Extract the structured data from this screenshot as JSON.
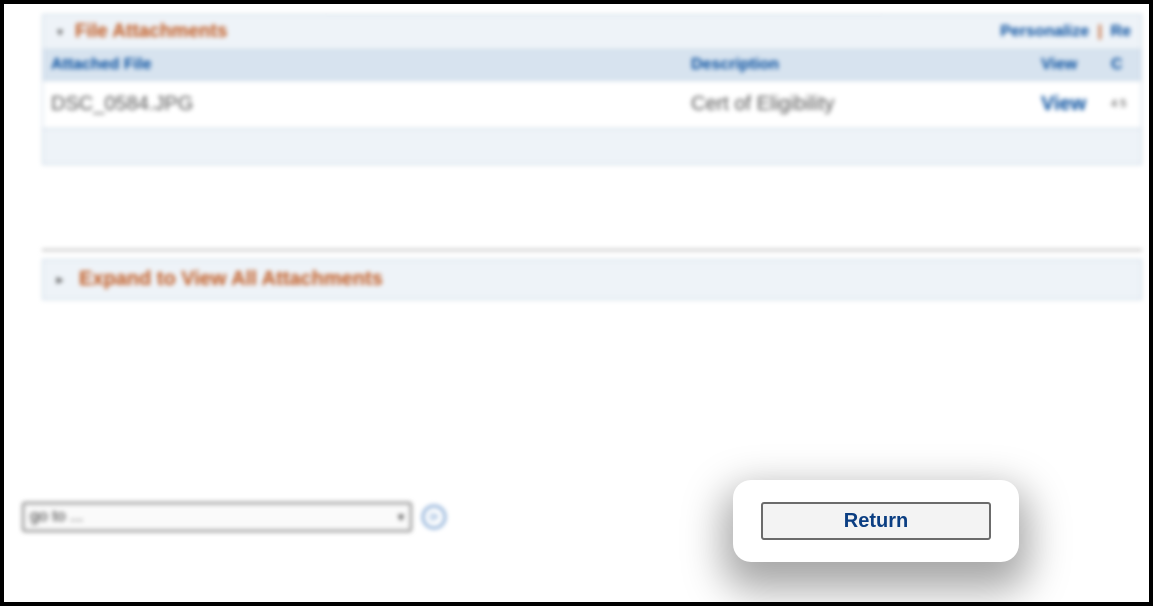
{
  "section": {
    "title": "File Attachments",
    "actions": {
      "personalize": "Personalize",
      "refresh": "Re"
    },
    "columns": {
      "file": "Attached File",
      "desc": "Description",
      "view": "View",
      "other": "C"
    },
    "rows": [
      {
        "file": "DSC_0584.JPG",
        "desc": "Cert of Eligibility",
        "view": "View",
        "other": "4\n5"
      }
    ]
  },
  "expand": {
    "label": "Expand to View All Attachments"
  },
  "nav": {
    "goto_placeholder": "go to ..."
  },
  "buttons": {
    "return": "Return"
  }
}
